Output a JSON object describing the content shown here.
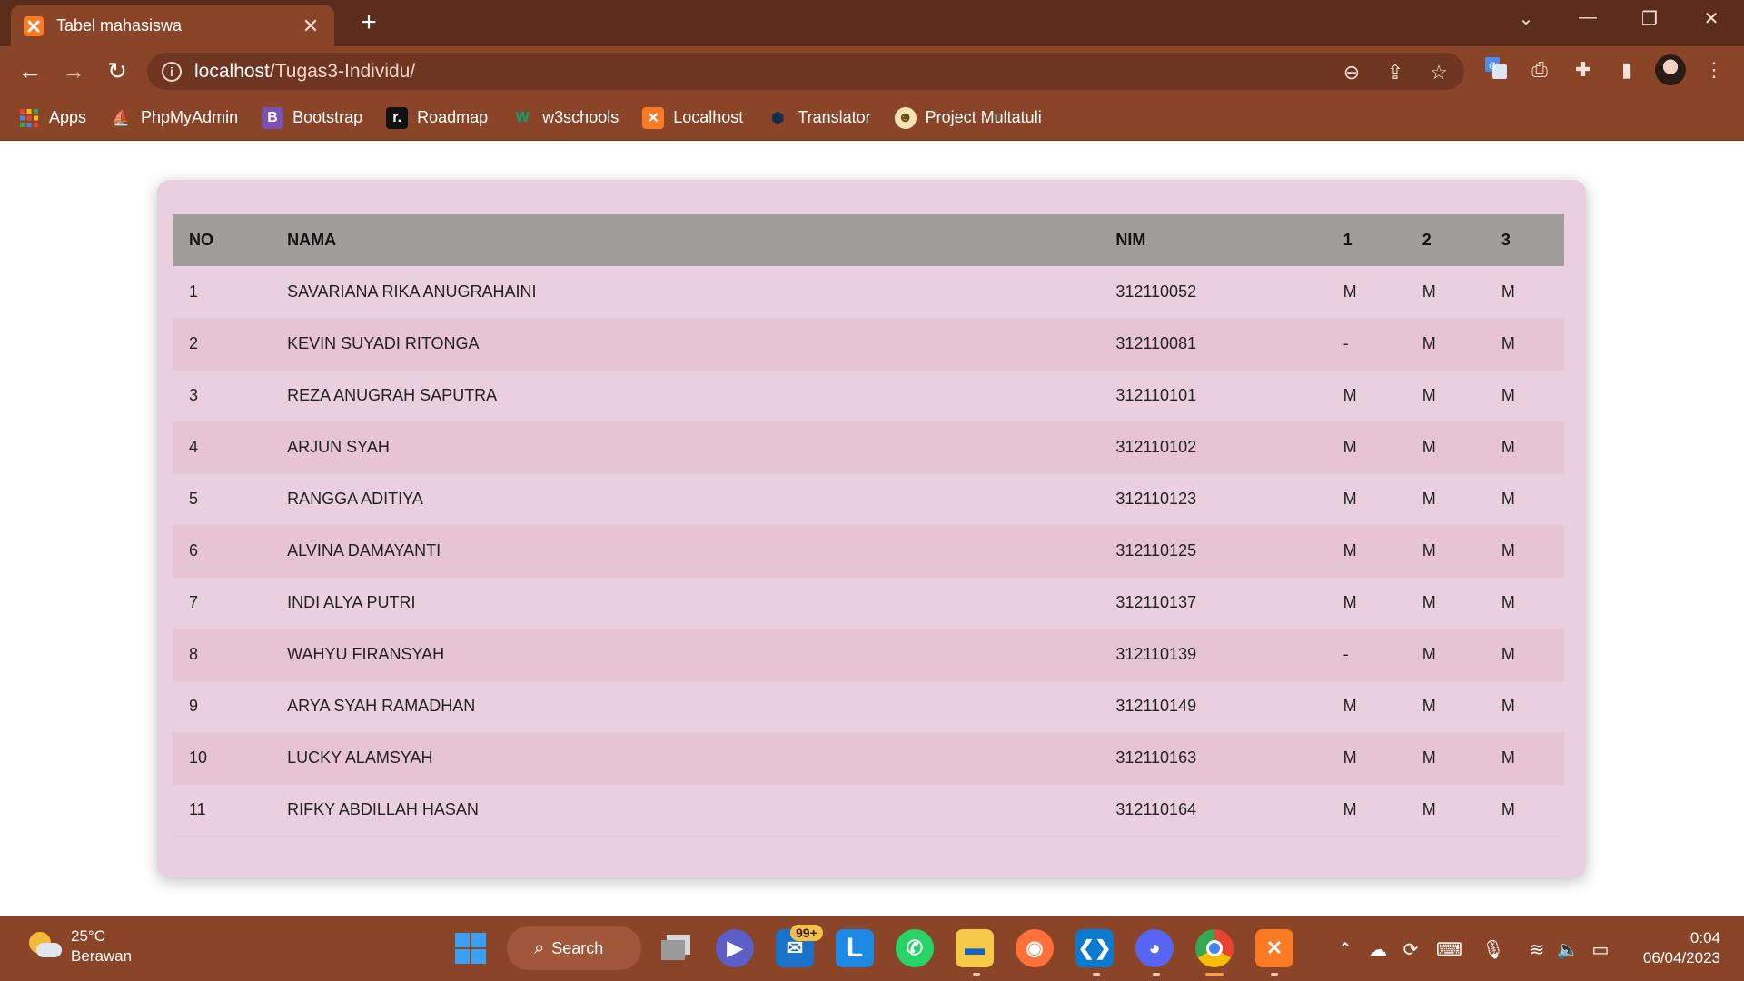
{
  "browser": {
    "tab_title": "Tabel mahasiswa",
    "tab_close": "✕",
    "new_tab": "+",
    "url_host": "localhost",
    "url_path": "/Tugas3-Individu/",
    "bookmarks": [
      {
        "label": "Apps",
        "icon": "apps-grid-icon"
      },
      {
        "label": "PhpMyAdmin",
        "icon": "phpmyadmin-icon"
      },
      {
        "label": "Bootstrap",
        "icon": "bootstrap-icon"
      },
      {
        "label": "Roadmap",
        "icon": "roadmap-icon"
      },
      {
        "label": "w3schools",
        "icon": "w3schools-icon"
      },
      {
        "label": "Localhost",
        "icon": "xampp-icon"
      },
      {
        "label": "Translator",
        "icon": "translator-icon"
      },
      {
        "label": "Project Multatuli",
        "icon": "multatuli-icon"
      }
    ]
  },
  "table": {
    "headers": [
      "NO",
      "NAMA",
      "NIM",
      "1",
      "2",
      "3"
    ],
    "rows": [
      [
        "1",
        "SAVARIANA RIKA ANUGRAHAINI",
        "312110052",
        "M",
        "M",
        "M"
      ],
      [
        "2",
        "KEVIN SUYADI RITONGA",
        "312110081",
        "-",
        "M",
        "M"
      ],
      [
        "3",
        "REZA ANUGRAH SAPUTRA",
        "312110101",
        "M",
        "M",
        "M"
      ],
      [
        "4",
        "ARJUN SYAH",
        "312110102",
        "M",
        "M",
        "M"
      ],
      [
        "5",
        "RANGGA ADITIYA",
        "312110123",
        "M",
        "M",
        "M"
      ],
      [
        "6",
        "ALVINA DAMAYANTI",
        "312110125",
        "M",
        "M",
        "M"
      ],
      [
        "7",
        "INDI ALYA PUTRI",
        "312110137",
        "M",
        "M",
        "M"
      ],
      [
        "8",
        "WAHYU FIRANSYAH",
        "312110139",
        "-",
        "M",
        "M"
      ],
      [
        "9",
        "ARYA SYAH RAMADHAN",
        "312110149",
        "M",
        "M",
        "M"
      ],
      [
        "10",
        "LUCKY ALAMSYAH",
        "312110163",
        "M",
        "M",
        "M"
      ],
      [
        "11",
        "RIFKY ABDILLAH HASAN",
        "312110164",
        "M",
        "M",
        "M"
      ]
    ]
  },
  "taskbar": {
    "weather_temp": "25°C",
    "weather_cond": "Berawan",
    "search_label": "Search",
    "mail_badge": "99+",
    "time": "0:04",
    "date": "06/04/2023"
  },
  "colors": {
    "chrome_dark": "#5a2d1a",
    "chrome": "#8a4528",
    "card_bg": "#ead0de",
    "header_row": "#a29d9d",
    "alt_row": "#e7c4d4"
  }
}
